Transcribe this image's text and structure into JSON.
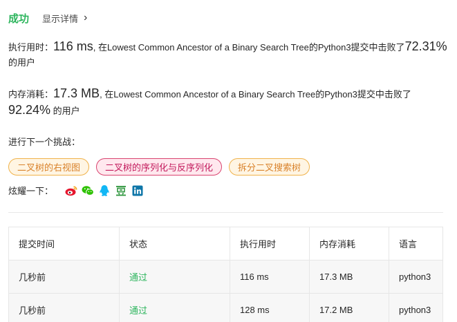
{
  "header": {
    "status": "成功",
    "details_link": "显示详情"
  },
  "runtime": {
    "label": "执行用时：",
    "value": "116 ms",
    "middle": ", 在Lowest Common Ancestor of a Binary Search Tree的Python3提交中击败了",
    "percent": "72.31%",
    "suffix": " 的用户"
  },
  "memory": {
    "label": "内存消耗：",
    "value": "17.3 MB",
    "middle": ", 在Lowest Common Ancestor of a Binary Search Tree的Python3提交中击败了",
    "percent": "92.24%",
    "suffix": " 的用户"
  },
  "next_challenge": {
    "label": "进行下一个挑战：",
    "tags": [
      {
        "label": "二叉树的右视图",
        "difficulty": "medium"
      },
      {
        "label": "二叉树的序列化与反序列化",
        "difficulty": "hard"
      },
      {
        "label": "拆分二叉搜索树",
        "difficulty": "medium"
      }
    ]
  },
  "share": {
    "label": "炫耀一下：",
    "icons": [
      "weibo-icon",
      "wechat-icon",
      "qq-icon",
      "douban-icon",
      "linkedin-icon"
    ]
  },
  "table": {
    "headers": [
      "提交时间",
      "状态",
      "执行用时",
      "内存消耗",
      "语言"
    ],
    "rows": [
      [
        "几秒前",
        "通过",
        "116 ms",
        "17.3 MB",
        "python3"
      ],
      [
        "几秒前",
        "通过",
        "128 ms",
        "17.2 MB",
        "python3"
      ]
    ]
  },
  "colors": {
    "success": "#2db55d",
    "medium_tag": "#f0b24a",
    "hard_tag": "#d9436f"
  }
}
